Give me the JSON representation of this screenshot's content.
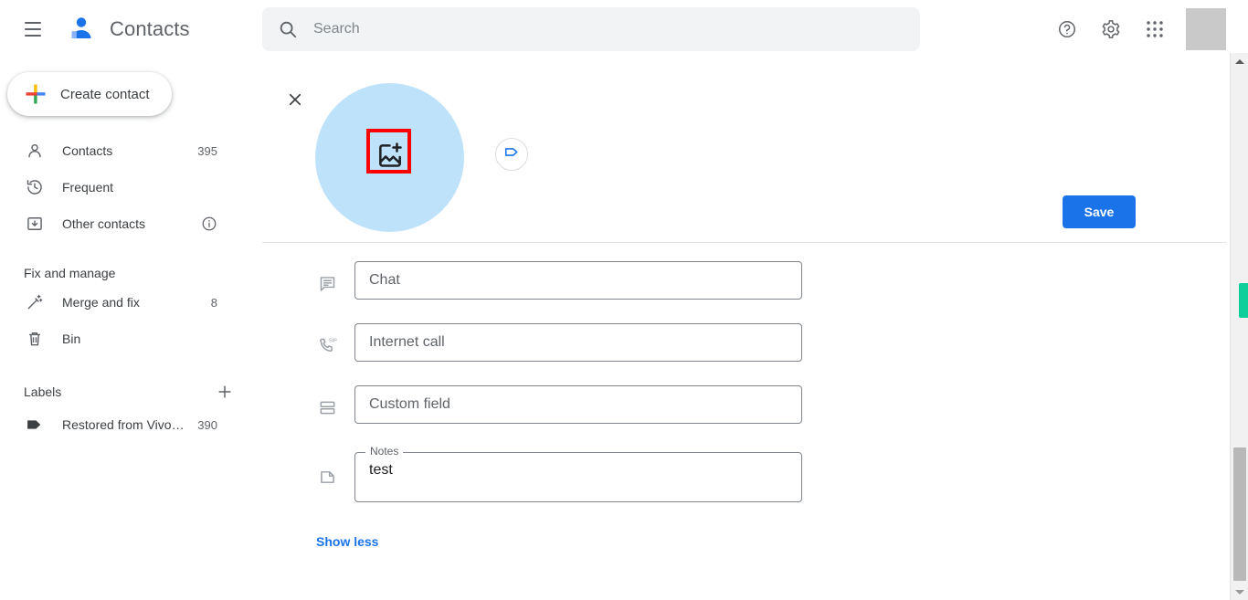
{
  "header": {
    "menu_icon": "hamburger-menu-icon",
    "logo_icon": "contacts-logo-icon",
    "title": "Contacts",
    "search": {
      "icon": "search-icon",
      "placeholder": "Search",
      "value": ""
    },
    "actions": [
      {
        "icon": "help-icon",
        "name": "help-button"
      },
      {
        "icon": "gear-icon",
        "name": "settings-button"
      },
      {
        "icon": "apps-grid-icon",
        "name": "google-apps-button"
      }
    ],
    "avatar": {
      "name": "account-avatar",
      "color": "#c9c9c9"
    }
  },
  "sidebar": {
    "create": {
      "label": "Create contact",
      "icon": "plus-icon"
    },
    "nav": [
      {
        "label": "Contacts",
        "count": "395",
        "icon": "person-icon"
      },
      {
        "label": "Frequent",
        "count": "",
        "icon": "history-clock-icon"
      },
      {
        "label": "Other contacts",
        "count": "",
        "icon": "archive-box-icon",
        "trailing_icon": "info-icon"
      }
    ],
    "fix_section": {
      "title": "Fix and manage",
      "items": [
        {
          "label": "Merge and fix",
          "count": "8",
          "icon": "magic-wand-icon"
        },
        {
          "label": "Bin",
          "count": "",
          "icon": "trash-bin-icon"
        }
      ]
    },
    "labels_section": {
      "title": "Labels",
      "add_icon": "plus-icon",
      "items": [
        {
          "label": "Restored from Vivo…",
          "count": "390",
          "icon": "label-tag-icon"
        }
      ]
    }
  },
  "main": {
    "close_icon": "close-x-icon",
    "photo": {
      "name": "contact-photo-placeholder",
      "icon": "add-photo-icon",
      "circle_color": "#bfe2fb",
      "highlight_color": "#ff0000"
    },
    "label_button": {
      "icon": "label-tag-icon",
      "color": "#1a73e8"
    },
    "save_button": {
      "label": "Save",
      "color": "#1a73e8"
    },
    "fields": [
      {
        "icon": "chat-bubble-icon",
        "name": "chat-field",
        "placeholder": "Chat",
        "value": ""
      },
      {
        "icon": "sip-phone-icon",
        "name": "internet-call-field",
        "placeholder": "Internet call",
        "value": ""
      },
      {
        "icon": "custom-rows-icon",
        "name": "custom-field",
        "placeholder": "Custom field",
        "value": ""
      }
    ],
    "notes": {
      "icon": "note-page-icon",
      "legend": "Notes",
      "value": "test",
      "placeholder": ""
    },
    "show_less": "Show less"
  },
  "scrollbar": {
    "up_arrow": "scroll-up-arrow-icon",
    "down_arrow": "scroll-down-arrow-icon",
    "marker_color": "#0ecf9a",
    "thumb_color": "#b8b8b8"
  }
}
